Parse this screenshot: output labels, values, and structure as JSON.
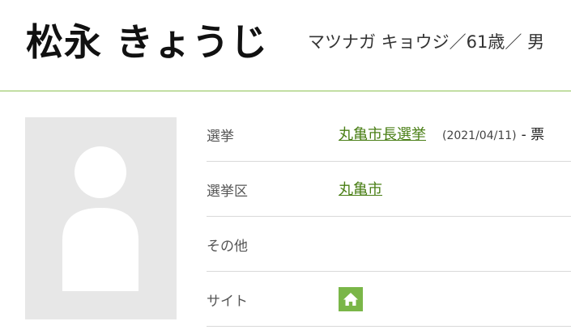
{
  "profile": {
    "name": "松永 きょうじ",
    "kana_info": "マツナガ キョウジ／61歳／ 男"
  },
  "info": {
    "rows": [
      {
        "label": "選挙",
        "link": "丸亀市長選挙",
        "date": "(2021/04/11)",
        "votes": "- 票"
      },
      {
        "label": "選挙区",
        "link": "丸亀市"
      },
      {
        "label": "その他"
      },
      {
        "label": "サイト",
        "icon": "home-icon"
      }
    ]
  },
  "colors": {
    "accent": "#8cc152",
    "link": "#4a7f16",
    "icon_bg": "#7ab648",
    "photo_bg": "#e7e7e7"
  }
}
